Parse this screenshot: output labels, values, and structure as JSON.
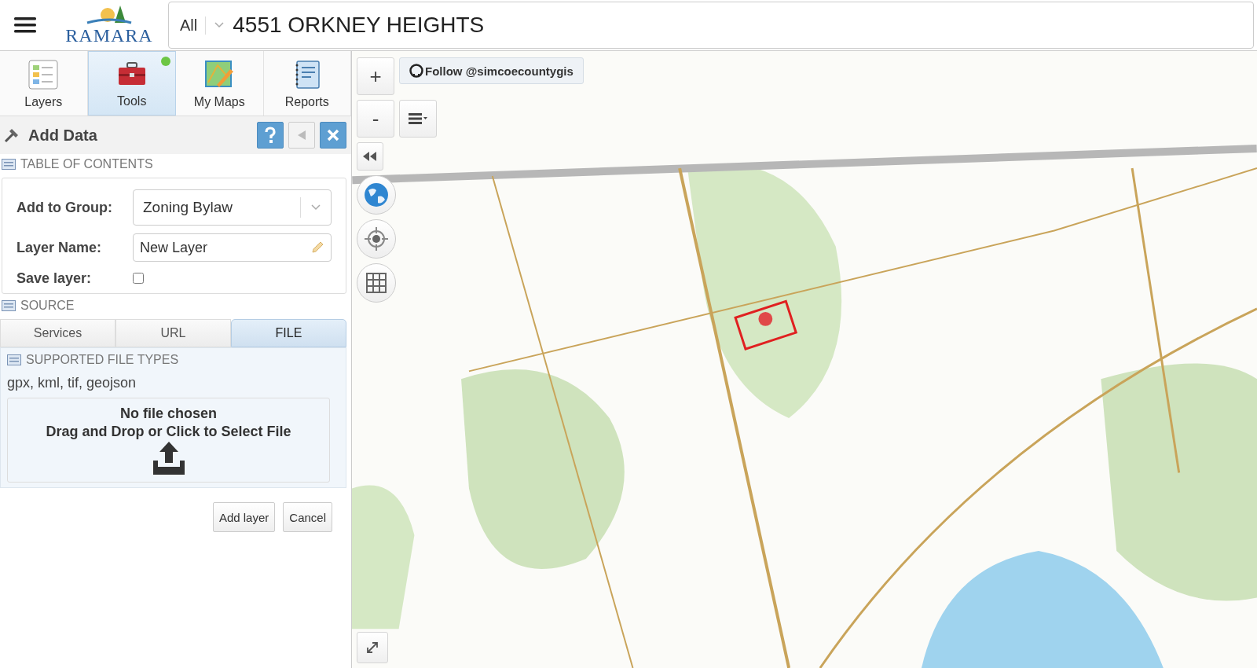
{
  "header": {
    "logo_text": "RAMARA",
    "search": {
      "scope": "All",
      "value": "4551 ORKNEY HEIGHTS"
    }
  },
  "tabs": [
    {
      "label": "Layers",
      "selected": false,
      "kind": "layers",
      "notification": false
    },
    {
      "label": "Tools",
      "selected": true,
      "kind": "tools",
      "notification": true
    },
    {
      "label": "My Maps",
      "selected": false,
      "kind": "mymaps",
      "notification": false
    },
    {
      "label": "Reports",
      "selected": false,
      "kind": "reports",
      "notification": false
    }
  ],
  "panel": {
    "title": "Add Data",
    "toc_heading": "TABLE OF CONTENTS",
    "form": {
      "group_label": "Add to Group:",
      "group_value": "Zoning Bylaw",
      "name_label": "Layer Name:",
      "name_value": "New Layer",
      "save_label": "Save layer:",
      "save_checked": false
    },
    "source_heading": "SOURCE",
    "source_tabs": [
      {
        "label": "Services",
        "selected": false
      },
      {
        "label": "URL",
        "selected": false
      },
      {
        "label": "FILE",
        "selected": true
      }
    ],
    "file_types_heading": "SUPPORTED FILE TYPES",
    "file_types": "gpx, kml, tif, geojson",
    "drop_status": "No file chosen",
    "drop_hint": "Drag and Drop or Click to Select File",
    "buttons": [
      "Add layer",
      "Cancel"
    ]
  },
  "map": {
    "follow_button": "Follow @simcoecountygis",
    "zoom_in": "+",
    "zoom_out": "-"
  }
}
